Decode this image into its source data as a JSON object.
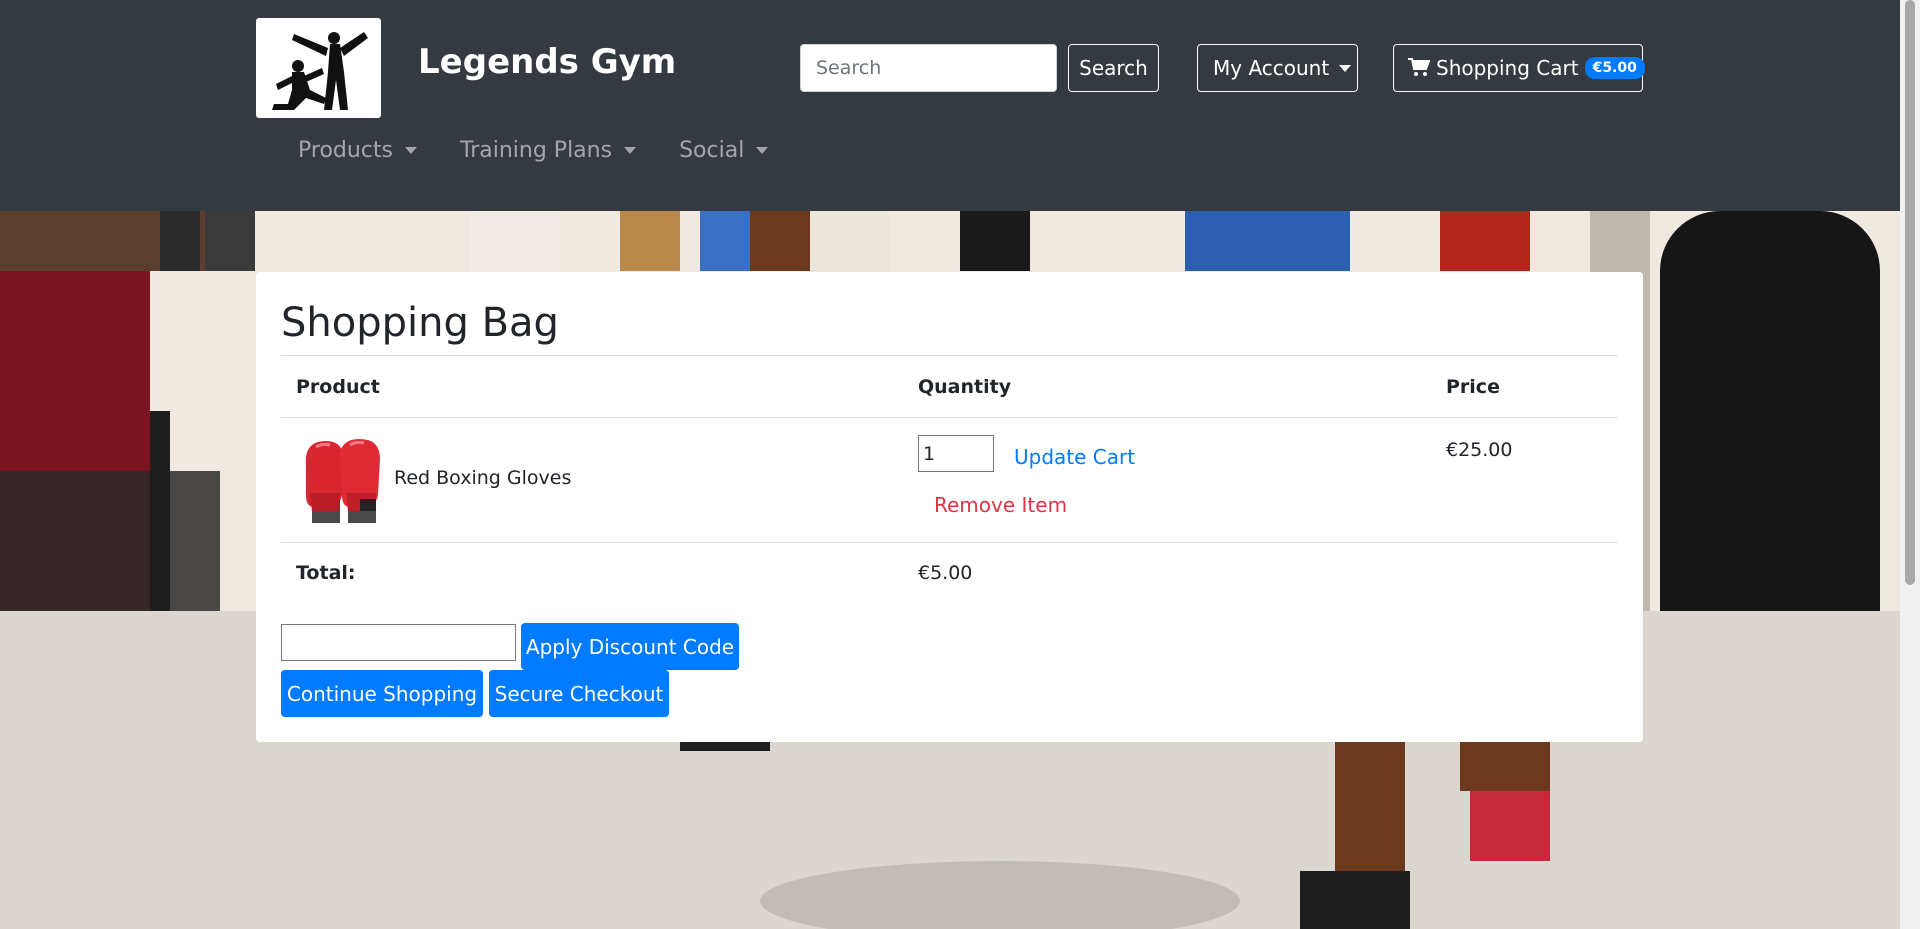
{
  "header": {
    "brand": "Legends Gym",
    "search_placeholder": "Search",
    "search_button": "Search",
    "account_button": "My Account",
    "cart_label": "Shopping Cart",
    "cart_badge": "€5.00"
  },
  "nav": {
    "items": [
      {
        "label": "Products"
      },
      {
        "label": "Training Plans"
      },
      {
        "label": "Social"
      }
    ]
  },
  "bag": {
    "title": "Shopping Bag",
    "columns": [
      "Product",
      "Quantity",
      "Price"
    ],
    "items": [
      {
        "name": "Red Boxing Gloves",
        "quantity": "1",
        "price": "€25.00",
        "update_label": "Update Cart",
        "remove_label": "Remove Item"
      }
    ],
    "total_label": "Total:",
    "total_value": "€5.00",
    "discount_button": "Apply Discount Code",
    "continue_button": "Continue Shopping",
    "checkout_button": "Secure Checkout"
  },
  "colors": {
    "navbar": "#343a40",
    "primary": "#007bff",
    "danger": "#dc3545"
  }
}
